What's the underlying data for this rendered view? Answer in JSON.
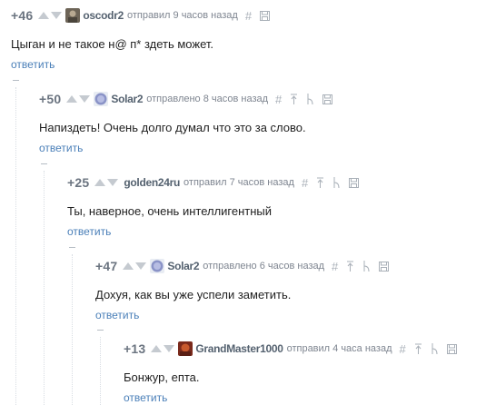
{
  "comments": [
    {
      "rating": "+46",
      "author": "oscodr2",
      "avatar": "user-avatar-photo",
      "meta": "отправил 9 часов назад",
      "text": "Цыган и не такое н@ п* здеть может.",
      "reply": "ответить"
    },
    {
      "rating": "+50",
      "author": "Solar2",
      "avatar": "user-avatar-blue",
      "meta": "отправлено 8 часов назад",
      "text": "Напиздеть! Очень долго думал что это за слово.",
      "reply": "ответить"
    },
    {
      "rating": "+25",
      "author": "golden24ru",
      "avatar": "",
      "meta": "отправил 7 часов назад",
      "text": "Ты, наверное, очень интеллигентный",
      "reply": "ответить"
    },
    {
      "rating": "+47",
      "author": "Solar2",
      "avatar": "user-avatar-blue",
      "meta": "отправлено 6 часов назад",
      "text": "Дохуя, как вы уже успели заметить.",
      "reply": "ответить"
    },
    {
      "rating": "+13",
      "author": "GrandMaster1000",
      "avatar": "user-avatar-red",
      "meta": "отправил 4 часа назад",
      "text": "Бонжур, епта.",
      "reply": "ответить"
    }
  ],
  "icons": {
    "upvote": "arrow-up-icon",
    "downvote": "arrow-down-icon",
    "link": "hash-link-icon",
    "save": "save-icon",
    "parent": "go-to-parent-icon",
    "branch": "branch-icon",
    "collapse": "collapse-minus-icon"
  },
  "colors": {
    "rating": "#6b7480",
    "author": "#556270",
    "reply_link": "#4a7fb8",
    "icon": "#a9b0b8"
  }
}
